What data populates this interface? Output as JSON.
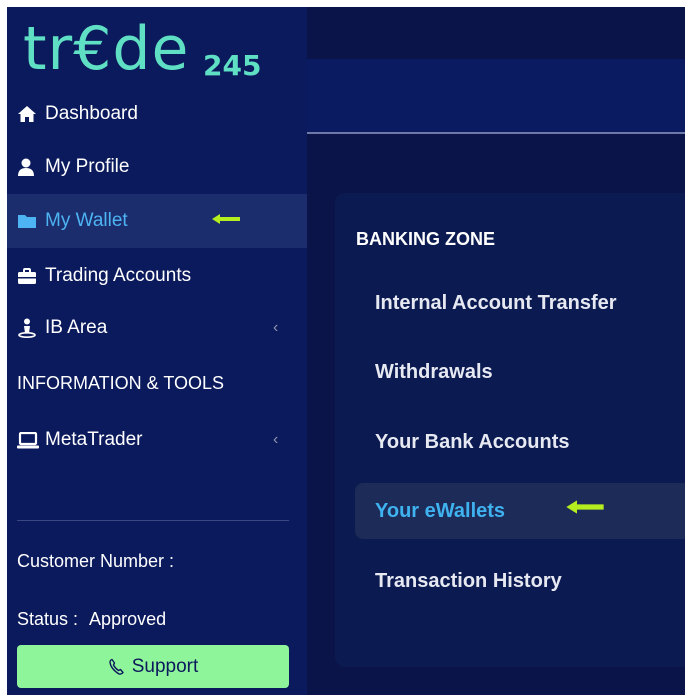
{
  "brand": {
    "logo_word": "tr€de",
    "logo_num": "245"
  },
  "sidebar": {
    "items": [
      {
        "label": "Dashboard",
        "icon": "home-icon"
      },
      {
        "label": "My Profile",
        "icon": "user-icon"
      },
      {
        "label": "My Wallet",
        "icon": "folder-icon",
        "active": true
      },
      {
        "label": "Trading Accounts",
        "icon": "briefcase-icon"
      },
      {
        "label": "IB Area",
        "icon": "ib-person-icon"
      }
    ],
    "section_title": "INFORMATION & TOOLS",
    "tools": [
      {
        "label": "MetaTrader",
        "icon": "laptop-icon"
      }
    ],
    "chevron": "‹",
    "customer_number_label": "Customer Number :",
    "status_label": "Status :",
    "status_value": "Approved",
    "support_label": "Support"
  },
  "banking_zone": {
    "title": "BANKING ZONE",
    "items": [
      {
        "label": "Internal Account Transfer"
      },
      {
        "label": "Withdrawals"
      },
      {
        "label": "Your Bank Accounts"
      },
      {
        "label": "Your eWallets",
        "active": true
      },
      {
        "label": "Transaction History"
      }
    ]
  },
  "colors": {
    "background": "#0a1449",
    "sidebar": "#0b1a5c",
    "active_bg": "#1c2d6d",
    "active_text": "#4db3f2",
    "support_bg": "#8ff59a",
    "annotation_arrow": "#b5ee1f",
    "logo": "#5fe0c4"
  }
}
